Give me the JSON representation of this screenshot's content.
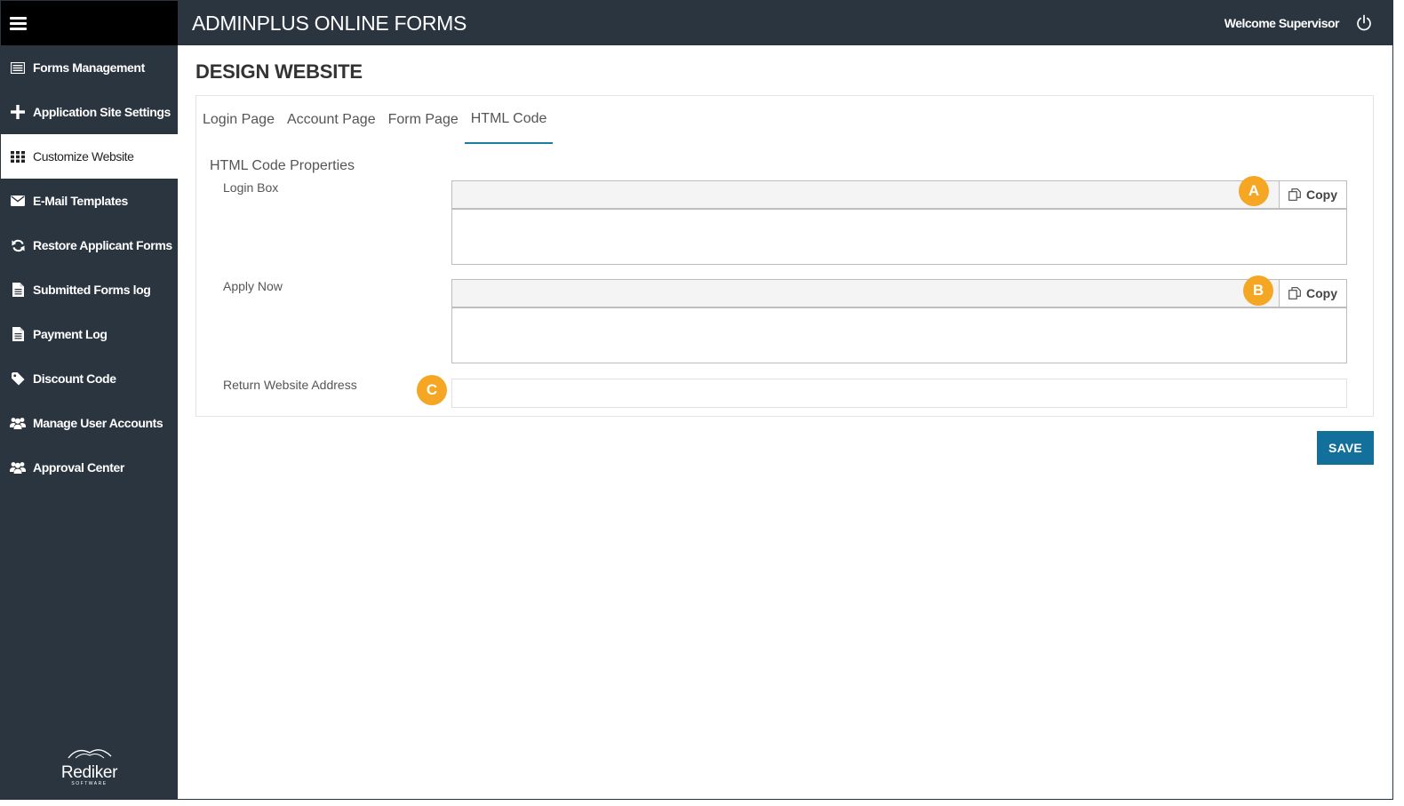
{
  "header": {
    "app_title": "ADMINPLUS ONLINE FORMS",
    "welcome": "Welcome Supervisor",
    "power_icon": "power-icon",
    "menu_icon": "hamburger-menu-icon"
  },
  "sidebar": {
    "items": [
      {
        "label": "Forms Management",
        "icon": "forms-list-icon",
        "active": false
      },
      {
        "label": "Application Site Settings",
        "icon": "plus-icon",
        "active": false
      },
      {
        "label": "Customize Website",
        "icon": "grid-icon",
        "active": true
      },
      {
        "label": "E-Mail Templates",
        "icon": "envelope-icon",
        "active": false
      },
      {
        "label": "Restore Applicant Forms",
        "icon": "refresh-icon",
        "active": false
      },
      {
        "label": "Submitted Forms log",
        "icon": "document-icon",
        "active": false
      },
      {
        "label": "Payment Log",
        "icon": "document-icon",
        "active": false
      },
      {
        "label": "Discount Code",
        "icon": "tag-icon",
        "active": false
      },
      {
        "label": "Manage User Accounts",
        "icon": "users-icon",
        "active": false
      },
      {
        "label": "Approval Center",
        "icon": "users-icon",
        "active": false
      }
    ],
    "logo": {
      "brand": "Rediker",
      "sub": "SOFTWARE"
    }
  },
  "main": {
    "page_title": "DESIGN WEBSITE",
    "tabs": [
      {
        "label": "Login Page",
        "active": false
      },
      {
        "label": "Account Page",
        "active": false
      },
      {
        "label": "Form Page",
        "active": false
      },
      {
        "label": "HTML Code",
        "active": true
      }
    ],
    "section_title": "HTML Code Properties",
    "fields": {
      "login_box": {
        "label": "Login Box",
        "value": "",
        "copy_label": "Copy",
        "marker": "A"
      },
      "apply_now": {
        "label": "Apply Now",
        "value": "",
        "copy_label": "Copy",
        "marker": "B"
      },
      "return_address": {
        "label": "Return Website Address",
        "value": "",
        "marker": "C"
      }
    },
    "save_label": "SAVE"
  },
  "colors": {
    "sidebar_bg": "#2b3540",
    "accent": "#12709a",
    "marker": "#f5a623"
  }
}
